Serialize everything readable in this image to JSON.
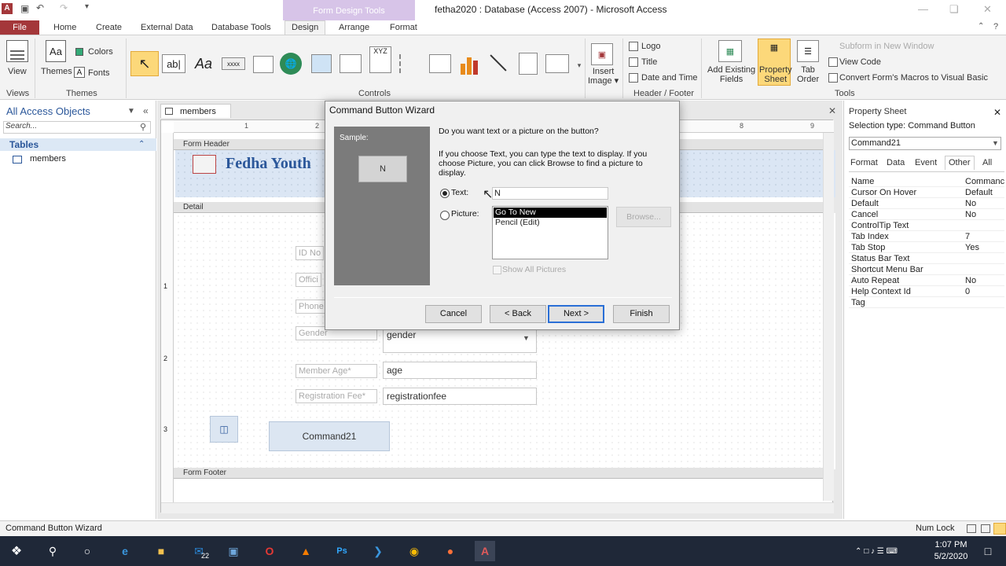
{
  "app": {
    "window_title": "fetha2020 : Database (Access 2007) - Microsoft Access",
    "contextual_tab_group": "Form Design Tools"
  },
  "ribbon_tabs": [
    "File",
    "Home",
    "Create",
    "External Data",
    "Database Tools",
    "Design",
    "Arrange",
    "Format"
  ],
  "ribbon": {
    "view_label": "View",
    "views_group": "Views",
    "themes_label": "Themes",
    "colors_label": "Colors",
    "fonts_label": "Fonts",
    "themes_group": "Themes",
    "controls_group": "Controls",
    "control_abl": "ab|",
    "control_aa": "Aa",
    "control_xxxx": "xxxx",
    "control_xyz": "XYZ",
    "insert_image": "Insert\nImage",
    "logo": "Logo",
    "title": "Title",
    "date_time": "Date and Time",
    "header_footer_group": "Header / Footer",
    "add_existing_fields": "Add Existing\nFields",
    "property_sheet": "Property\nSheet",
    "tab_order": "Tab\nOrder",
    "subform_new_window": "Subform in New Window",
    "view_code": "View Code",
    "convert_macros": "Convert Form's Macros to Visual Basic",
    "tools_group": "Tools"
  },
  "nav": {
    "header": "All Access Objects",
    "search_placeholder": "Search...",
    "group": "Tables",
    "items": [
      "members"
    ]
  },
  "document": {
    "tab": "members",
    "form_header": "Form Header",
    "detail": "Detail",
    "form_footer": "Form Footer",
    "header_title": "Fedha Youth",
    "fields": [
      {
        "label": "ID No",
        "value": ""
      },
      {
        "label": "Offici",
        "value": ""
      },
      {
        "label": "Phone",
        "value": ""
      },
      {
        "label": "Gender",
        "value": "gender"
      },
      {
        "label": "Member Age*",
        "value": "age"
      },
      {
        "label": "Registration Fee*",
        "value": "registrationfee"
      }
    ],
    "command_button": "Command21",
    "ruler_numbers": [
      "1",
      "2",
      "8",
      "9"
    ],
    "vruler_numbers": [
      "1",
      "2",
      "3"
    ]
  },
  "wizard": {
    "title": "Command Button Wizard",
    "sample_label": "Sample:",
    "sample_text": "N",
    "question": "Do you want text or a picture on the button?",
    "instructions": "If you choose Text, you can type the text to display.  If you choose Picture, you can click Browse to find a picture to display.",
    "text_option": "Text:",
    "picture_option": "Picture:",
    "text_value": "N",
    "pictures": [
      "Go To New",
      "Pencil (Edit)"
    ],
    "browse": "Browse...",
    "show_all": "Show All Pictures",
    "cancel": "Cancel",
    "back": "< Back",
    "next": "Next >",
    "finish": "Finish"
  },
  "property_sheet": {
    "title": "Property Sheet",
    "selection_type": "Selection type:  Command Button",
    "selected": "Command21",
    "tabs": [
      "Format",
      "Data",
      "Event",
      "Other",
      "All"
    ],
    "rows": [
      {
        "k": "Name",
        "v": "Commanc"
      },
      {
        "k": "Cursor On Hover",
        "v": "Default"
      },
      {
        "k": "Default",
        "v": "No"
      },
      {
        "k": "Cancel",
        "v": "No"
      },
      {
        "k": "ControlTip Text",
        "v": ""
      },
      {
        "k": "Tab Index",
        "v": "7"
      },
      {
        "k": "Tab Stop",
        "v": "Yes"
      },
      {
        "k": "Status Bar Text",
        "v": ""
      },
      {
        "k": "Shortcut Menu Bar",
        "v": ""
      },
      {
        "k": "Auto Repeat",
        "v": "No"
      },
      {
        "k": "Help Context Id",
        "v": "0"
      },
      {
        "k": "Tag",
        "v": ""
      }
    ]
  },
  "statusbar": {
    "left": "Command Button Wizard",
    "num_lock": "Num Lock"
  },
  "taskbar": {
    "time": "1:07 PM",
    "date": "5/2/2020",
    "mail_badge": "22"
  },
  "colors": {
    "file_tab": "#a4373a",
    "contextual": "#d7c4e8",
    "taskbar": "#1f2838"
  }
}
